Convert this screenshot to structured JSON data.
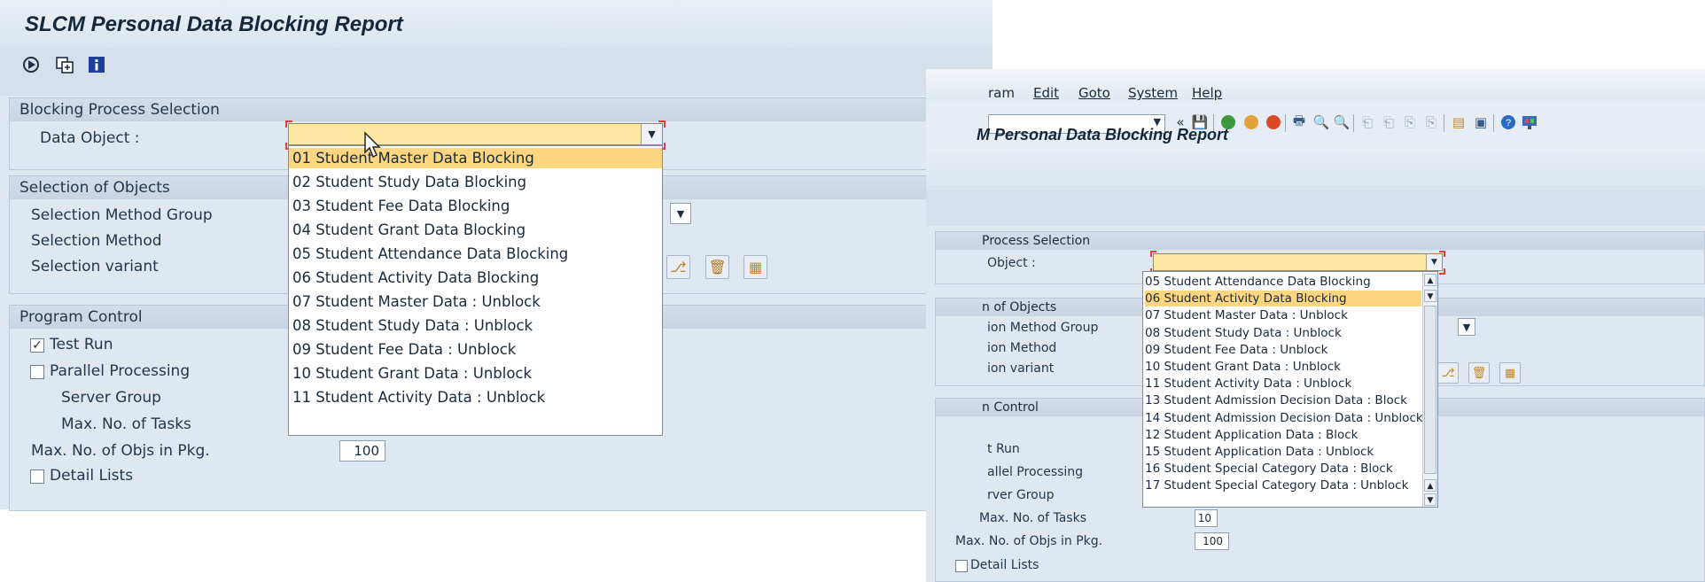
{
  "left_window": {
    "title": "SLCM Personal Data Blocking Report",
    "toolbar_icons": [
      "execute-icon",
      "variant-icon",
      "info-icon"
    ],
    "blocking_group": {
      "header": "Blocking Process Selection",
      "data_object_label": "Data Object :"
    },
    "dropdown_options": [
      "01 Student Master Data Blocking",
      "02 Student Study Data Blocking",
      "03 Student Fee Data Blocking",
      "04 Student Grant Data Blocking",
      "05 Student Attendance Data Blocking",
      "06 Student Activity Data Blocking",
      "07 Student Master Data : Unblock",
      "08 Student Study Data : Unblock",
      "09 Student Fee Data : Unblock",
      "10 Student Grant Data : Unblock",
      "11 Student Activity Data : Unblock"
    ],
    "dropdown_selected_index": 0,
    "selection_group": {
      "header": "Selection of Objects",
      "method_group_label": "Selection Method Group",
      "method_label": "Selection Method",
      "variant_label": "Selection variant"
    },
    "program_group": {
      "header": "Program Control",
      "test_run_label": "Test Run",
      "test_run_checked": true,
      "parallel_label": "Parallel Processing",
      "parallel_checked": false,
      "server_group_label": "Server Group",
      "max_tasks_label": "Max. No. of Tasks",
      "max_objs_label": "Max. No. of Objs in Pkg.",
      "max_objs_value": "100",
      "detail_lists_label": "Detail Lists",
      "detail_lists_checked": false
    }
  },
  "right_window": {
    "menu": [
      "ram",
      "Edit",
      "Goto",
      "System",
      "Help"
    ],
    "title": "M Personal Data Blocking Report",
    "blocking_header": "Process Selection",
    "data_object_label": "Object :",
    "selection_header": "n of Objects",
    "method_group_label": "ion Method Group",
    "method_label": "ion Method",
    "variant_label": "ion variant",
    "program_header": "n Control",
    "test_run_label": "t Run",
    "parallel_label": "allel Processing",
    "server_group_label": "rver Group",
    "max_tasks_label": "Max. No. of Tasks",
    "max_tasks_value": "10",
    "max_objs_label": "Max. No. of Objs in Pkg.",
    "max_objs_value": "100",
    "detail_lists_label": "Detail Lists",
    "dropdown_options": [
      "05 Student Attendance Data Blocking",
      "06 Student Activity Data Blocking",
      "07 Student Master Data : Unblock",
      "08 Student Study Data : Unblock",
      "09 Student Fee Data : Unblock",
      "10 Student Grant Data : Unblock",
      "11 Student Activity Data : Unblock",
      "13 Student Admission Decision Data : Block",
      "14 Student Admission Decision Data : Unblock",
      "12 Student Application Data : Block",
      "15 Student Application Data : Unblock",
      "16 Student Special Category Data : Block",
      "17 Student Special Category Data : Unblock"
    ],
    "dropdown_selected_index": 1
  },
  "colors": {
    "background": "#dfe8f1",
    "selected_option": "#fcd680",
    "dropdown_field": "#fde8a3",
    "focus_corner": "#e0403a"
  }
}
